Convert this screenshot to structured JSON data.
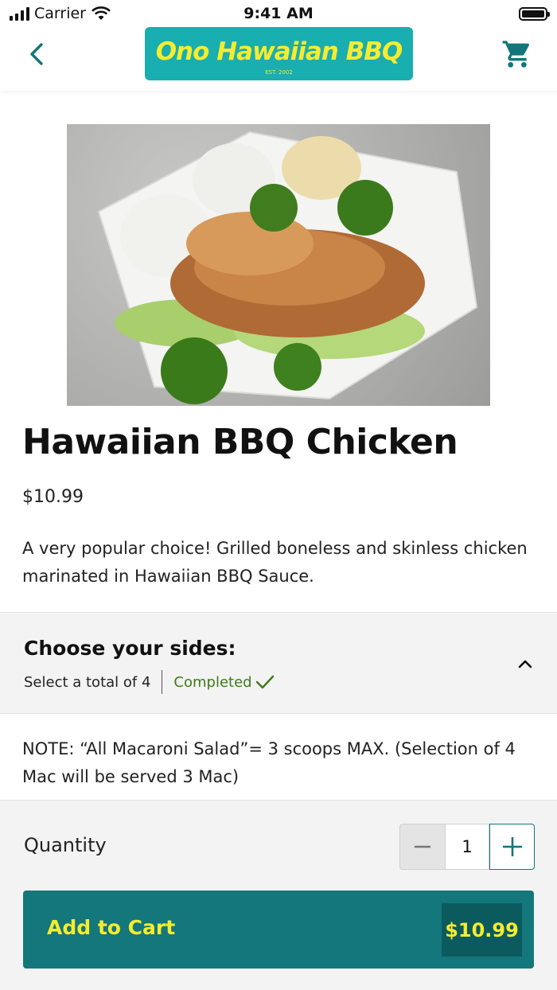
{
  "status_bar": {
    "carrier": "Carrier",
    "time": "9:41 AM"
  },
  "header": {
    "logo_text": "Ono Hawaiian BBQ",
    "logo_sub": "EST. 2002"
  },
  "item": {
    "title": "Hawaiian BBQ Chicken",
    "price": "$10.99",
    "description": "A very popular choice! Grilled boneless and skinless chicken marinated in Hawaiian BBQ Sauce."
  },
  "sides": {
    "title": "Choose your sides:",
    "instruction": "Select a total of 4",
    "status": "Completed"
  },
  "note": "NOTE: “All Macaroni Salad”= 3 scoops MAX. (Selection of 4 Mac will be served 3 Mac)",
  "quantity": {
    "label": "Quantity",
    "value": "1"
  },
  "add_to_cart": {
    "label": "Add to Cart",
    "price": "$10.99"
  },
  "colors": {
    "brand_teal": "#19aeb0",
    "brand_yellow": "#f6ec2e",
    "button_teal": "#13777b",
    "completed_green": "#3f7a1a"
  }
}
